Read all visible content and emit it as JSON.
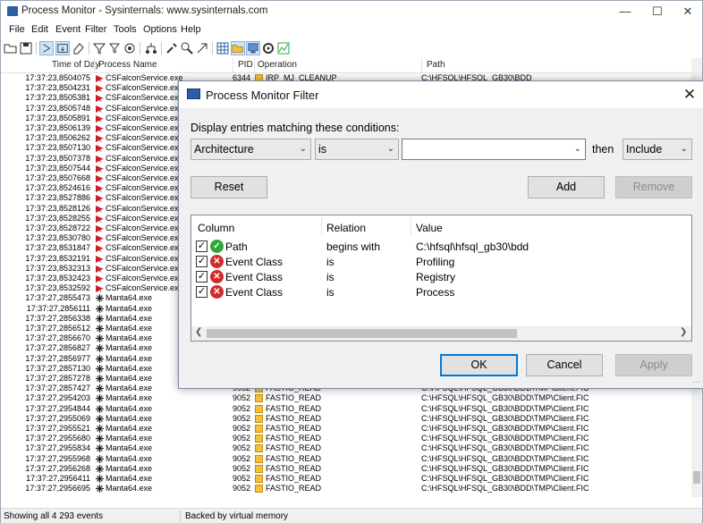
{
  "window": {
    "title": "Process Monitor - Sysinternals: www.sysinternals.com",
    "controls": [
      "—",
      "☐",
      "✕"
    ]
  },
  "menu": [
    "File",
    "Edit",
    "Event",
    "Filter",
    "Tools",
    "Options",
    "Help"
  ],
  "toolbar_icons": [
    "open-icon",
    "save-icon",
    "capture-icon",
    "autoscroll-icon",
    "clear-icon",
    "filter-icon",
    "highlight-icon",
    "include-process-icon",
    "properties-icon",
    "find-icon",
    "jump-icon",
    "process-tree-icon",
    "registry-icon",
    "filesystem-icon",
    "network-icon",
    "process-thread-icon",
    "profiling-icon"
  ],
  "columns": {
    "time": "Time of Day",
    "process": "Process Name",
    "pid": "PID",
    "operation": "Operation",
    "path": "Path"
  },
  "rows": [
    {
      "time": "17:37:23,8504075",
      "proc": "CSFalconService.exe",
      "pid": "6344",
      "op": "IRP_MJ_CLEANUP",
      "path": "C:\\HFSQL\\HFSQL_GB30\\BDD",
      "kind": "falcon"
    },
    {
      "time": "17:37:23,8504231",
      "proc": "CSFalconService.exe",
      "pid": "",
      "op": "",
      "path": "",
      "kind": "falcon"
    },
    {
      "time": "17:37:23,8505381",
      "proc": "CSFalconService.exe",
      "pid": "",
      "op": "",
      "path": "",
      "kind": "falcon"
    },
    {
      "time": "17:37:23,8505748",
      "proc": "CSFalconService.exe",
      "pid": "",
      "op": "",
      "path": "",
      "kind": "falcon"
    },
    {
      "time": "17:37:23,8505891",
      "proc": "CSFalconService.exe",
      "pid": "",
      "op": "",
      "path": "",
      "kind": "falcon"
    },
    {
      "time": "17:37:23,8506139",
      "proc": "CSFalconService.exe",
      "pid": "",
      "op": "",
      "path": "",
      "kind": "falcon"
    },
    {
      "time": "17:37:23,8506262",
      "proc": "CSFalconService.exe",
      "pid": "",
      "op": "",
      "path": "",
      "kind": "falcon"
    },
    {
      "time": "17:37:23,8507130",
      "proc": "CSFalconService.exe",
      "pid": "",
      "op": "",
      "path": "",
      "kind": "falcon"
    },
    {
      "time": "17:37:23,8507378",
      "proc": "CSFalconService.exe",
      "pid": "",
      "op": "",
      "path": "",
      "kind": "falcon"
    },
    {
      "time": "17:37:23,8507544",
      "proc": "CSFalconService.exe",
      "pid": "",
      "op": "",
      "path": "",
      "kind": "falcon"
    },
    {
      "time": "17:37:23,8507668",
      "proc": "CSFalconService.exe",
      "pid": "",
      "op": "",
      "path": "",
      "kind": "falcon"
    },
    {
      "time": "17:37:23,8524616",
      "proc": "CSFalconService.exe",
      "pid": "",
      "op": "",
      "path": "",
      "kind": "falcon"
    },
    {
      "time": "17:37:23,8527886",
      "proc": "CSFalconService.exe",
      "pid": "",
      "op": "",
      "path": "",
      "kind": "falcon"
    },
    {
      "time": "17:37:23,8528126",
      "proc": "CSFalconService.exe",
      "pid": "",
      "op": "",
      "path": "",
      "kind": "falcon"
    },
    {
      "time": "17:37:23,8528255",
      "proc": "CSFalconService.exe",
      "pid": "",
      "op": "",
      "path": "",
      "kind": "falcon"
    },
    {
      "time": "17:37:23,8528722",
      "proc": "CSFalconService.exe",
      "pid": "",
      "op": "",
      "path": "",
      "kind": "falcon"
    },
    {
      "time": "17:37:23,8530780",
      "proc": "CSFalconService.exe",
      "pid": "",
      "op": "",
      "path": "",
      "kind": "falcon"
    },
    {
      "time": "17:37:23,8531847",
      "proc": "CSFalconService.exe",
      "pid": "",
      "op": "",
      "path": "",
      "kind": "falcon"
    },
    {
      "time": "17:37:23,8532191",
      "proc": "CSFalconService.exe",
      "pid": "",
      "op": "",
      "path": "",
      "kind": "falcon"
    },
    {
      "time": "17:37:23,8532313",
      "proc": "CSFalconService.exe",
      "pid": "",
      "op": "",
      "path": "",
      "kind": "falcon"
    },
    {
      "time": "17:37:23,8532423",
      "proc": "CSFalconService.exe",
      "pid": "",
      "op": "",
      "path": "",
      "kind": "falcon"
    },
    {
      "time": "17:37:23,8532592",
      "proc": "CSFalconService.exe",
      "pid": "",
      "op": "",
      "path": "",
      "kind": "falcon"
    },
    {
      "time": "17:37:27,2855473",
      "proc": "Manta64.exe",
      "pid": "",
      "op": "",
      "path": "",
      "kind": "manta"
    },
    {
      "time": "17:37:27,2856111",
      "proc": "Manta64.exe",
      "pid": "",
      "op": "",
      "path": "",
      "kind": "manta"
    },
    {
      "time": "17:37:27,2856338",
      "proc": "Manta64.exe",
      "pid": "",
      "op": "",
      "path": "",
      "kind": "manta"
    },
    {
      "time": "17:37:27,2856512",
      "proc": "Manta64.exe",
      "pid": "",
      "op": "",
      "path": "",
      "kind": "manta"
    },
    {
      "time": "17:37:27,2856670",
      "proc": "Manta64.exe",
      "pid": "",
      "op": "",
      "path": "",
      "kind": "manta"
    },
    {
      "time": "17:37:27,2856827",
      "proc": "Manta64.exe",
      "pid": "",
      "op": "",
      "path": "",
      "kind": "manta"
    },
    {
      "time": "17:37:27,2856977",
      "proc": "Manta64.exe",
      "pid": "",
      "op": "",
      "path": "",
      "kind": "manta"
    },
    {
      "time": "17:37:27,2857130",
      "proc": "Manta64.exe",
      "pid": "",
      "op": "",
      "path": "",
      "kind": "manta"
    },
    {
      "time": "17:37:27,2857278",
      "proc": "Manta64.exe",
      "pid": "",
      "op": "",
      "path": "",
      "kind": "manta"
    },
    {
      "time": "17:37:27,2857427",
      "proc": "Manta64.exe",
      "pid": "9052",
      "op": "FASTIO_READ",
      "path": "C:\\HFSQL\\HFSQL_GB30\\BDD\\TMP\\Client.FIC",
      "kind": "manta"
    },
    {
      "time": "17:37:27,2954203",
      "proc": "Manta64.exe",
      "pid": "9052",
      "op": "FASTIO_READ",
      "path": "C:\\HFSQL\\HFSQL_GB30\\BDD\\TMP\\Client.FIC",
      "kind": "manta"
    },
    {
      "time": "17:37:27,2954844",
      "proc": "Manta64.exe",
      "pid": "9052",
      "op": "FASTIO_READ",
      "path": "C:\\HFSQL\\HFSQL_GB30\\BDD\\TMP\\Client.FIC",
      "kind": "manta"
    },
    {
      "time": "17:37:27,2955069",
      "proc": "Manta64.exe",
      "pid": "9052",
      "op": "FASTIO_READ",
      "path": "C:\\HFSQL\\HFSQL_GB30\\BDD\\TMP\\Client.FIC",
      "kind": "manta"
    },
    {
      "time": "17:37:27,2955521",
      "proc": "Manta64.exe",
      "pid": "9052",
      "op": "FASTIO_READ",
      "path": "C:\\HFSQL\\HFSQL_GB30\\BDD\\TMP\\Client.FIC",
      "kind": "manta"
    },
    {
      "time": "17:37:27,2955680",
      "proc": "Manta64.exe",
      "pid": "9052",
      "op": "FASTIO_READ",
      "path": "C:\\HFSQL\\HFSQL_GB30\\BDD\\TMP\\Client.FIC",
      "kind": "manta"
    },
    {
      "time": "17:37:27,2955834",
      "proc": "Manta64.exe",
      "pid": "9052",
      "op": "FASTIO_READ",
      "path": "C:\\HFSQL\\HFSQL_GB30\\BDD\\TMP\\Client.FIC",
      "kind": "manta"
    },
    {
      "time": "17:37:27,2955968",
      "proc": "Manta64.exe",
      "pid": "9052",
      "op": "FASTIO_READ",
      "path": "C:\\HFSQL\\HFSQL_GB30\\BDD\\TMP\\Client.FIC",
      "kind": "manta"
    },
    {
      "time": "17:37:27,2956268",
      "proc": "Manta64.exe",
      "pid": "9052",
      "op": "FASTIO_READ",
      "path": "C:\\HFSQL\\HFSQL_GB30\\BDD\\TMP\\Client.FIC",
      "kind": "manta"
    },
    {
      "time": "17:37:27,2956411",
      "proc": "Manta64.exe",
      "pid": "9052",
      "op": "FASTIO_READ",
      "path": "C:\\HFSQL\\HFSQL_GB30\\BDD\\TMP\\Client.FIC",
      "kind": "manta"
    },
    {
      "time": "17:37:27,2956695",
      "proc": "Manta64.exe",
      "pid": "9052",
      "op": "FASTIO_READ",
      "path": "C:\\HFSQL\\HFSQL_GB30\\BDD\\TMP\\Client.FIC",
      "kind": "manta"
    }
  ],
  "status": {
    "events": "Showing all 4 293 events",
    "memory": "Backed by virtual memory"
  },
  "dialog": {
    "title": "Process Monitor Filter",
    "close": "✕",
    "prompt": "Display entries matching these conditions:",
    "column_select": "Architecture",
    "relation_select": "is",
    "value_input": "",
    "then_label": "then",
    "action_select": "Include",
    "reset": "Reset",
    "add": "Add",
    "remove": "Remove",
    "list_headers": {
      "column": "Column",
      "relation": "Relation",
      "value": "Value"
    },
    "filters": [
      {
        "checked": true,
        "status": "include",
        "column": "Path",
        "relation": "begins with",
        "value": "C:\\hfsql\\hfsql_gb30\\bdd"
      },
      {
        "checked": true,
        "status": "exclude",
        "column": "Event Class",
        "relation": "is",
        "value": "Profiling"
      },
      {
        "checked": true,
        "status": "exclude",
        "column": "Event Class",
        "relation": "is",
        "value": "Registry"
      },
      {
        "checked": true,
        "status": "exclude",
        "column": "Event Class",
        "relation": "is",
        "value": "Process"
      }
    ],
    "ok": "OK",
    "cancel": "Cancel",
    "apply": "Apply"
  },
  "colors": {
    "accent": "#0078d7",
    "include": "#2fa839",
    "exclude": "#d42a2a",
    "folder": "#f3c13a"
  }
}
